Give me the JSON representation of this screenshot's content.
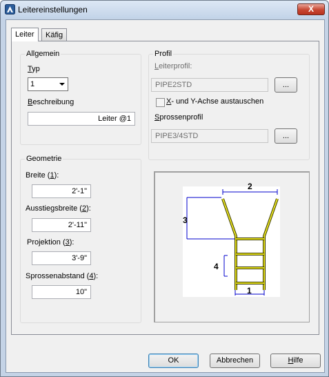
{
  "window": {
    "title": "Leitereinstellungen",
    "close_symbol": "X"
  },
  "tabs": [
    {
      "label": "Leiter"
    },
    {
      "label": "Käfig"
    }
  ],
  "allgemein": {
    "title": "Allgemein",
    "typ_label": "Typ",
    "typ_value": "1",
    "beschreibung_label": "Beschreibung",
    "beschreibung_value": "Leiter @1"
  },
  "profil": {
    "title": "Profil",
    "leiterprofil_label": "Leiterprofil:",
    "leiterprofil_value": "PIPE2STD",
    "leiterprofil_button": "...",
    "swap_label": "X- und Y-Achse austauschen",
    "swap_checked": false,
    "sprossenprofil_label": "Sprossenprofil",
    "sprossenprofil_value": "PIPE3/4STD",
    "sprossenprofil_button": "..."
  },
  "geometrie": {
    "title": "Geometrie",
    "breite_label": "Breite (1):",
    "breite_value": "2'-1\"",
    "ausstieg_label": "Ausstiegsbreite (2):",
    "ausstieg_value": "2'-11\"",
    "projektion_label": "Projektion (3):",
    "projektion_value": "3'-9\"",
    "sprossen_label": "Sprossenabstand (4):",
    "sprossen_value": "10\""
  },
  "preview": {
    "labels": [
      "1",
      "2",
      "3",
      "4"
    ]
  },
  "buttons": {
    "ok": "OK",
    "cancel": "Abbrechen",
    "help": "Hilfe"
  }
}
